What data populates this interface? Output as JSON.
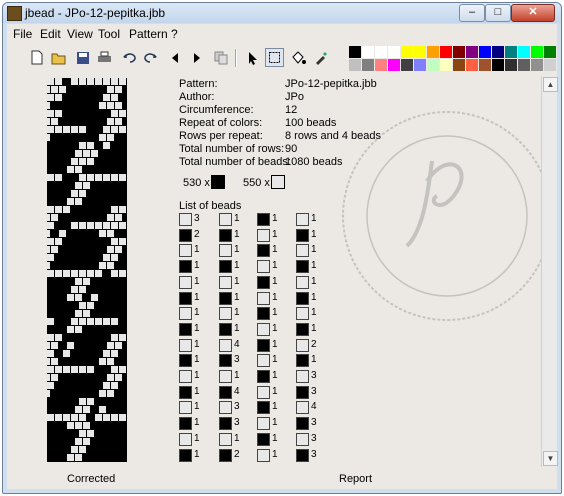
{
  "window": {
    "title": "jbead - JPo-12-pepitka.jbb",
    "btn_min": "–",
    "btn_max": "□",
    "btn_close": "✕"
  },
  "menu": [
    {
      "label": "File"
    },
    {
      "label": "Edit"
    },
    {
      "label": "View"
    },
    {
      "label": "Tool"
    },
    {
      "label": "Pattern"
    },
    {
      "label": "?"
    }
  ],
  "toolbar": [
    "new-icon",
    "open-icon",
    "save-icon",
    "print-icon",
    "undo-icon",
    "redo-icon",
    "arrow-left-icon",
    "arrow-right-icon",
    "copy-icon",
    "pointer-icon",
    "select-icon",
    "fill-icon",
    "picker-icon"
  ],
  "palette_colors": [
    "#000000",
    "#ffffff",
    "#ffffff",
    "#ffffff",
    "#ffff00",
    "#ffff00",
    "#ffa000",
    "#ff0000",
    "#800000",
    "#800080",
    "#0000ff",
    "#000080",
    "#008080",
    "#00ffff",
    "#00ff00",
    "#008000",
    "#c0c0c0",
    "#808080",
    "#ff8080",
    "#ff00ff",
    "#404040",
    "#8080ff",
    "#c0ffc0",
    "#ffffc0",
    "#8b4513",
    "#ff6040",
    "#a0522d",
    "#000000",
    "#303030",
    "#606060",
    "#909090",
    "#d0d0d0"
  ],
  "report": {
    "pattern_label": "Pattern:",
    "pattern": "JPo-12-pepitka.jbb",
    "author_label": "Author:",
    "author": "JPo",
    "circ_label": "Circumference:",
    "circ": "12",
    "repeat_label": "Repeat of colors:",
    "repeat": "100 beads",
    "rpr_label": "Rows per repeat:",
    "rpr": "8 rows and 4 beads",
    "rows_label": "Total number of rows:",
    "rows": "90",
    "beads_label": "Total number of beads:",
    "beads": "1080 beads",
    "count_black": "530 x",
    "count_white": "550 x",
    "list_label": "List of beads"
  },
  "bead_columns": [
    [
      [
        "w",
        "3"
      ],
      [
        "b",
        "2"
      ],
      [
        "w",
        "1"
      ],
      [
        "b",
        "1"
      ],
      [
        "w",
        "1"
      ],
      [
        "b",
        "1"
      ],
      [
        "w",
        "1"
      ],
      [
        "b",
        "1"
      ],
      [
        "w",
        "1"
      ],
      [
        "b",
        "1"
      ],
      [
        "w",
        "1"
      ],
      [
        "b",
        "1"
      ],
      [
        "w",
        "1"
      ],
      [
        "b",
        "1"
      ],
      [
        "w",
        "1"
      ],
      [
        "b",
        "1"
      ]
    ],
    [
      [
        "w",
        "1"
      ],
      [
        "b",
        "1"
      ],
      [
        "w",
        "1"
      ],
      [
        "b",
        "1"
      ],
      [
        "w",
        "1"
      ],
      [
        "b",
        "1"
      ],
      [
        "w",
        "1"
      ],
      [
        "b",
        "1"
      ],
      [
        "w",
        "4"
      ],
      [
        "b",
        "3"
      ],
      [
        "w",
        "1"
      ],
      [
        "b",
        "4"
      ],
      [
        "w",
        "3"
      ],
      [
        "b",
        "3"
      ],
      [
        "w",
        "1"
      ],
      [
        "b",
        "2"
      ]
    ],
    [
      [
        "b",
        "1"
      ],
      [
        "w",
        "1"
      ],
      [
        "b",
        "1"
      ],
      [
        "w",
        "1"
      ],
      [
        "b",
        "1"
      ],
      [
        "w",
        "1"
      ],
      [
        "b",
        "1"
      ],
      [
        "w",
        "1"
      ],
      [
        "b",
        "1"
      ],
      [
        "w",
        "1"
      ],
      [
        "b",
        "1"
      ],
      [
        "w",
        "1"
      ],
      [
        "b",
        "1"
      ],
      [
        "w",
        "1"
      ],
      [
        "b",
        "1"
      ],
      [
        "w",
        "1"
      ]
    ],
    [
      [
        "w",
        "1"
      ],
      [
        "b",
        "1"
      ],
      [
        "w",
        "1"
      ],
      [
        "b",
        "1"
      ],
      [
        "w",
        "1"
      ],
      [
        "b",
        "1"
      ],
      [
        "w",
        "1"
      ],
      [
        "b",
        "1"
      ],
      [
        "w",
        "2"
      ],
      [
        "b",
        "1"
      ],
      [
        "w",
        "3"
      ],
      [
        "b",
        "3"
      ],
      [
        "w",
        "4"
      ],
      [
        "b",
        "3"
      ],
      [
        "w",
        "3"
      ],
      [
        "b",
        "3"
      ]
    ]
  ],
  "labels": {
    "corrected": "Corrected",
    "report": "Report"
  }
}
